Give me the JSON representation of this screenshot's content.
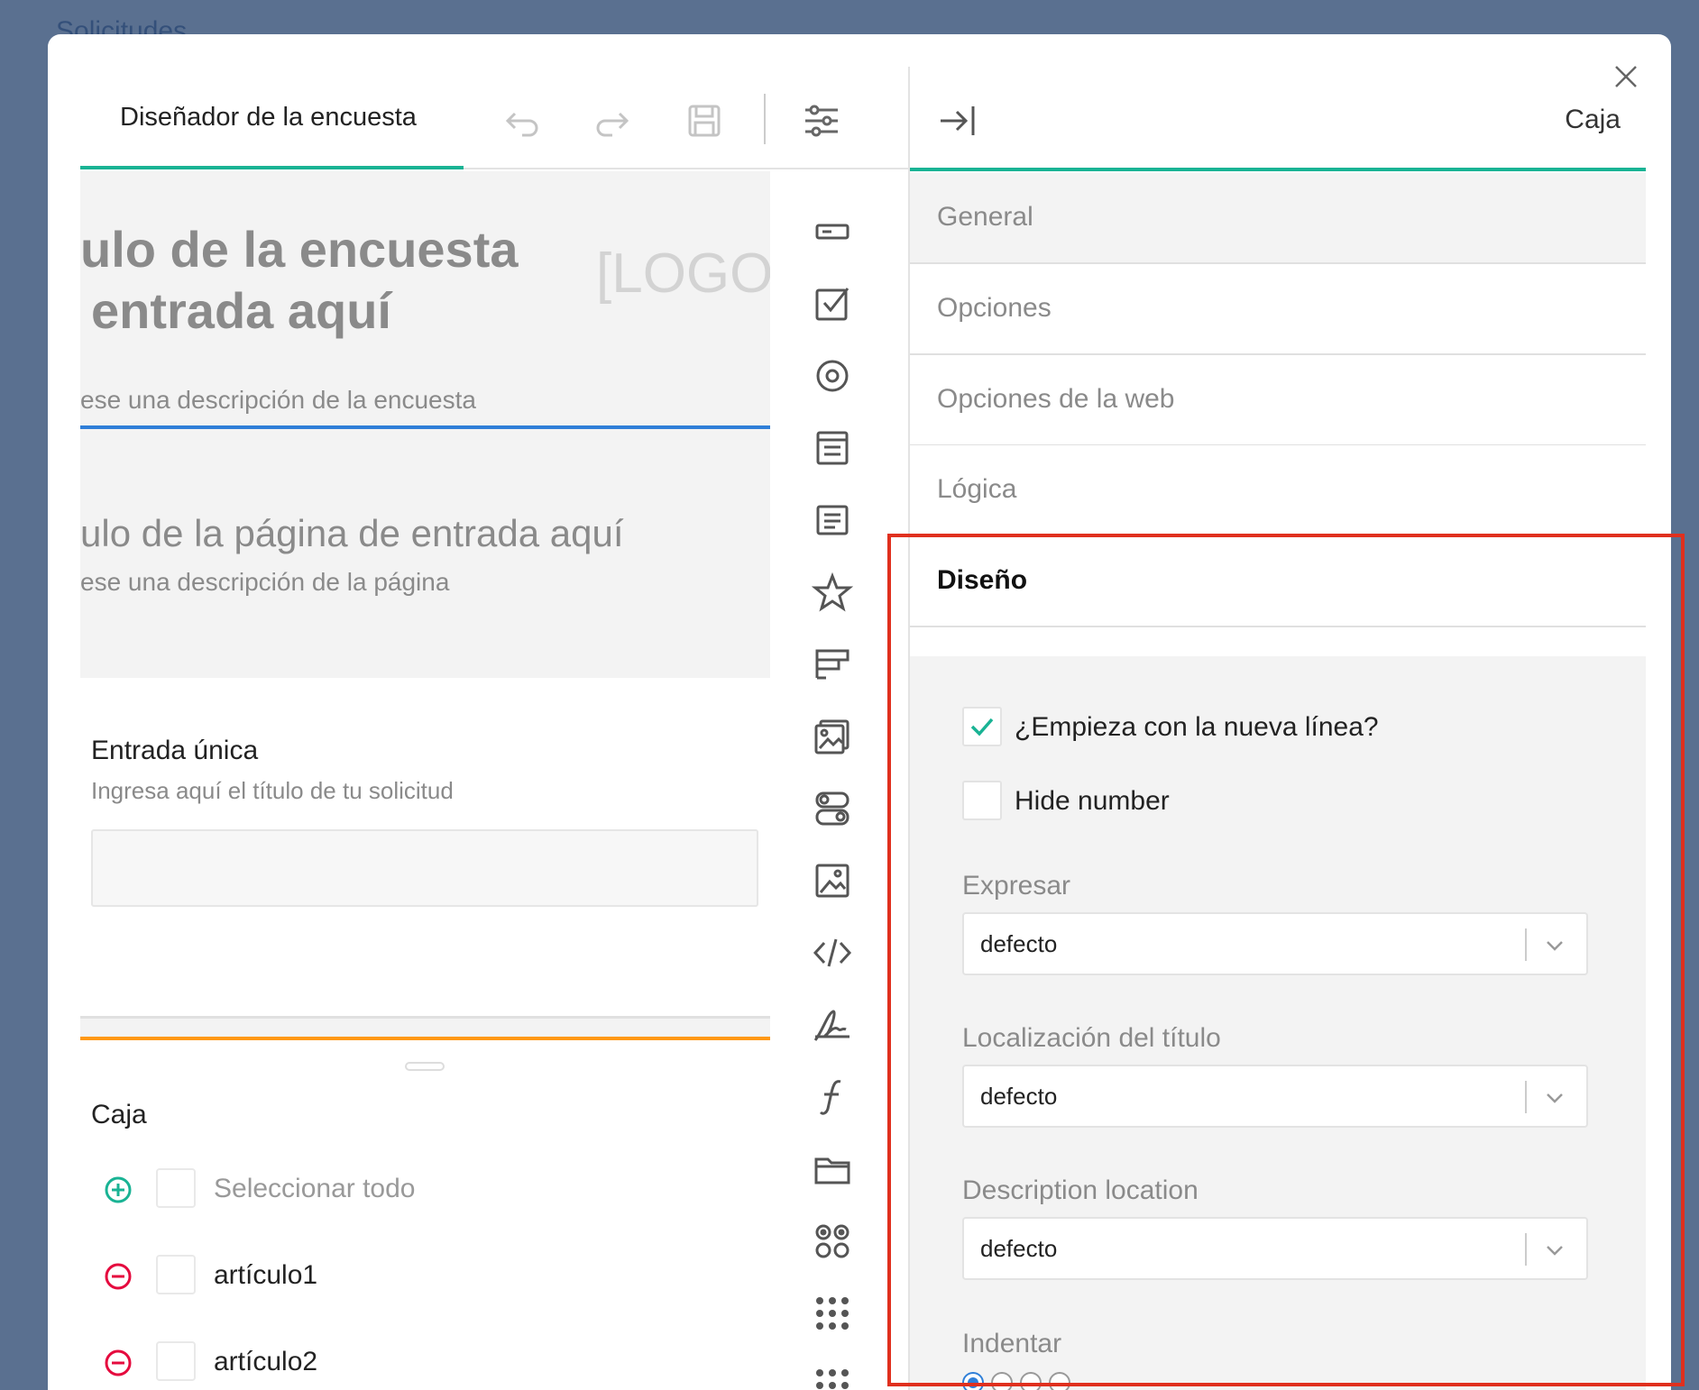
{
  "background": {
    "page_label": "Solicitudes"
  },
  "toolbar": {
    "tab_label": "Diseñador de la encuesta",
    "icons": [
      "undo-icon",
      "redo-icon",
      "save-icon",
      "settings-sliders-icon"
    ]
  },
  "survey": {
    "title_line1": "ulo de la encuesta",
    "title_line2": "entrada aquí",
    "description": "ese una descripción de la encuesta",
    "logo": "[LOGO]",
    "page_title": "ulo de la página de entrada aquí",
    "page_description": "ese una descripción de la página"
  },
  "question1": {
    "title": "Entrada única",
    "description": "Ingresa aquí el título de tu solicitud"
  },
  "question2": {
    "title": "Caja",
    "options": [
      {
        "label": "Seleccionar todo",
        "icon": "add-circle-icon"
      },
      {
        "label": "artículo1",
        "icon": "remove-circle-icon"
      },
      {
        "label": "artículo2",
        "icon": "remove-circle-icon"
      }
    ]
  },
  "toolbox": {
    "items": [
      "single-input-icon",
      "checkbox-icon",
      "radio-icon",
      "dropdown-icon",
      "comment-icon",
      "rating-icon",
      "ranking-icon",
      "image-picker-icon",
      "boolean-icon",
      "image-icon",
      "html-icon",
      "signature-icon",
      "expression-icon",
      "file-icon",
      "matrix-icon",
      "matrix-dropdown-icon",
      "matrix-dynamic-icon"
    ]
  },
  "properties": {
    "title": "Caja",
    "sections": [
      "General",
      "Opciones",
      "Opciones de la web",
      "Lógica",
      "Diseño"
    ],
    "active_section": "Diseño",
    "design": {
      "start_new_line": {
        "label": "¿Empieza con la nueva línea?",
        "checked": true
      },
      "hide_number": {
        "label": "Hide number",
        "checked": false
      },
      "render_as": {
        "label": "Expresar",
        "value": "defecto"
      },
      "title_location": {
        "label": "Localización del título",
        "value": "defecto"
      },
      "description_location": {
        "label": "Description location",
        "value": "defecto"
      },
      "indent": {
        "label": "Indentar",
        "selected": 0,
        "options": 4
      }
    }
  },
  "colors": {
    "accent": "#19b394",
    "highlight": "#e0301e",
    "primary": "#2f7fd8",
    "page_accent": "#ff9814",
    "error": "#e50a3e"
  }
}
